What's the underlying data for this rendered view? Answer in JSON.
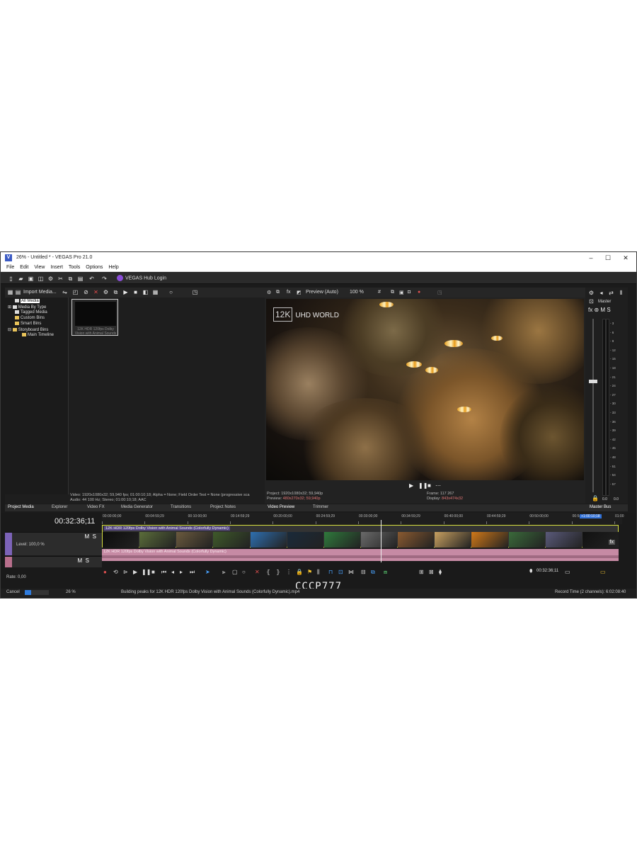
{
  "window": {
    "title": "26% - Untitled * - VEGAS Pro 21.0",
    "app_icon": "V",
    "controls": {
      "minimize": "–",
      "maximize": "☐",
      "close": "✕"
    }
  },
  "menu": [
    "File",
    "Edit",
    "View",
    "Insert",
    "Tools",
    "Options",
    "Help"
  ],
  "toolbar": {
    "hub_login": "VEGAS Hub Login"
  },
  "media": {
    "import_label": "Import Media...",
    "tree": [
      "All Media",
      "Media By Type",
      "Tagged Media",
      "Custom Bins",
      "Smart Bins",
      "Storyboard Bins",
      "Main Timeline"
    ],
    "thumb_caption": "12K HDR 120fps Dolby Vision with Animal Sounds",
    "props_line1": "Video: 1920x1080x32; 59,940 fps; 01:00:10;18; Alpha = None; Field Order Test = None (progressive sca",
    "props_line2": "Audio: 44 100 Hz; Stereo; 01:00:10;18; AAC"
  },
  "preview": {
    "mode": "Preview (Auto)",
    "zoom": "100 %",
    "logo_box": "12K",
    "logo_text": "UHD WORLD",
    "project_label": "Project:",
    "project_value": "1920x1080x32; 59,940p",
    "preview_label": "Preview:",
    "preview_value": "480x270x32; 59,940p",
    "frame_label": "Frame:",
    "frame_value": "117 267",
    "display_label": "Display:",
    "display_value": "843x474x32"
  },
  "master": {
    "label": "Master",
    "fx": "fx",
    "m": "M",
    "s": "S",
    "scale": [
      "3",
      "6",
      "9",
      "12",
      "15",
      "18",
      "21",
      "24",
      "27",
      "30",
      "33",
      "36",
      "39",
      "42",
      "45",
      "48",
      "51",
      "54",
      "57"
    ],
    "bottom_left": "0.0",
    "bottom_right": "0.0"
  },
  "tabs": {
    "left": [
      "Project Media",
      "Explorer",
      "Video FX",
      "Media Generator",
      "Transitions",
      "Project Notes"
    ],
    "middle": [
      "Video Preview",
      "Trimmer"
    ],
    "right": "Master Bus"
  },
  "timeline": {
    "timecode": "00:32:36;11",
    "video_track": {
      "m": "M",
      "s": "S",
      "level": "Level: 100,0 %"
    },
    "audio_track": {
      "m": "M",
      "s": "S"
    },
    "ruler": [
      "00:00:00;00",
      "00:04:59;29",
      "00:10:00;00",
      "00:14:59;29",
      "00:20:00;00",
      "00:24:59;29",
      "00:30:00;00",
      "00:34:59;29",
      "00:40:00;00",
      "00:44:59;29",
      "00:50:00;00",
      "00:54:59;29",
      "01:00"
    ],
    "clip_title": "12K HDR 120fps Dolby Vision with Animal Sounds (Colorfully Dynamic)",
    "audio_clip_title": "12K HDR 120fps Dolby Vision with Animal Sounds (Colorfully Dynamic)",
    "end_marker": "+1:00:10;18",
    "rate": "Rate: 0,00",
    "cursor_time": "00:32:36;11",
    "clip_fx": "fx"
  },
  "status": {
    "cancel": "Cancel",
    "progress_label": "26 %",
    "progress": 0.26,
    "message": "Building peaks for 12K HDR 120fps Dolby Vision with Animal Sounds (Colorfully Dynamic).mp4",
    "record_time": "Record Time (2 channels): 6:02:08:40"
  },
  "watermark": "СССР777"
}
